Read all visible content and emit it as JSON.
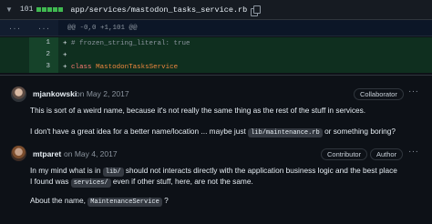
{
  "file": {
    "collapse_icon": "chevron-down-icon",
    "changed_lines": "101",
    "path": "app/services/mastodon_tasks_service.rb",
    "copy_icon": "copy-icon"
  },
  "hunk": {
    "old_gutter": "...",
    "new_gutter": "...",
    "header": "@@ -0,0 +1,101 @@"
  },
  "lines": [
    {
      "num": "1",
      "marker": "+",
      "text": "# frozen_string_literal: true"
    },
    {
      "num": "2",
      "marker": "+",
      "text": ""
    },
    {
      "num": "3",
      "marker": "+",
      "kw": "class",
      "cls": "MastodonTasksService"
    }
  ],
  "comments": [
    {
      "author": "mjankowski",
      "date": "on May 2, 2017",
      "badges": [
        "Collaborator"
      ],
      "p1": "This is sort of a weird name, because it's not really the same thing as the rest of the stuff in services.",
      "p2_before": "I don't have a great idea for a better name/location ... maybe just",
      "p2_code": "lib/maintenance.rb",
      "p2_after": "or something boring?"
    },
    {
      "author": "mtparet",
      "date": "on May 4, 2017",
      "badges": [
        "Contributor",
        "Author"
      ],
      "p1_before": "In my mind what is in",
      "p1_code": "lib/",
      "p1_after": "should not interacts directly with the application business logic and the best place",
      "p2_before": "I found was",
      "p2_code": "services/",
      "p2_after": "even if other stuff, here, are not the same.",
      "p3_before": "About the name,",
      "p3_code": "MaintenanceService",
      "p3_after": "?"
    }
  ],
  "colors": {
    "background": "#0d1117",
    "added_line": "#0f2f1f",
    "added_gutter": "#16432a",
    "keyword": "#ff7b72",
    "class_name": "#f0883e"
  }
}
